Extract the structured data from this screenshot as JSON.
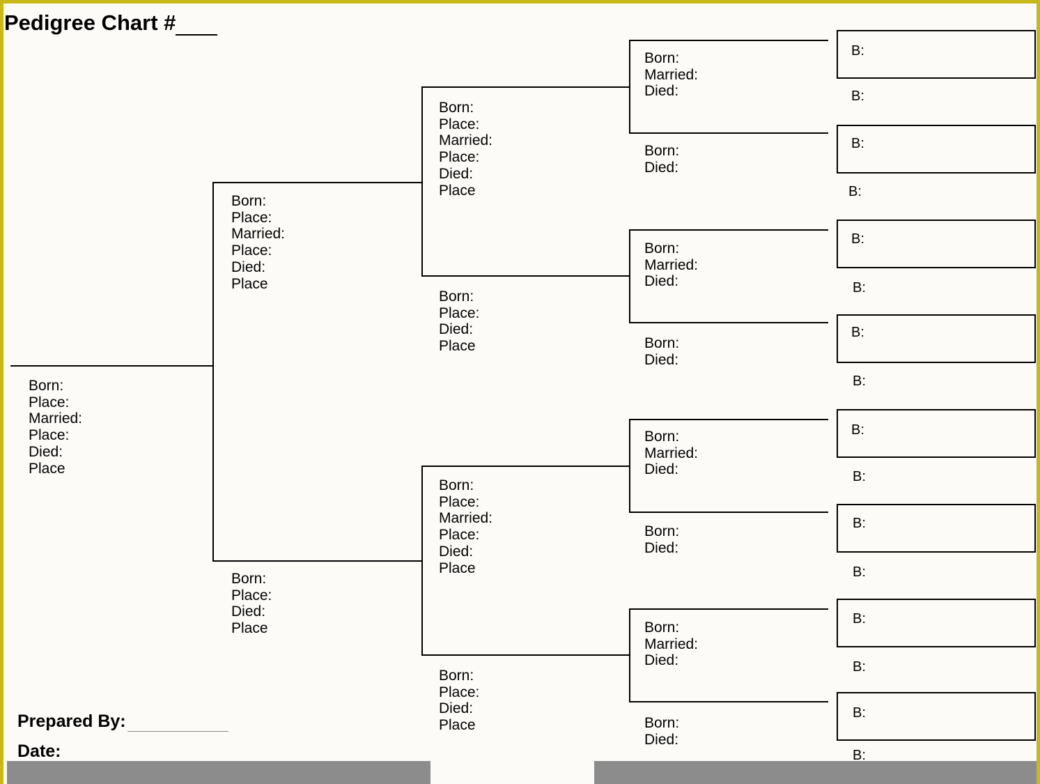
{
  "title_prefix": "Pedigree Chart #",
  "footer": {
    "prepared_by_label": "Prepared By:",
    "date_label": "Date:"
  },
  "labels": {
    "born": "Born:",
    "place": "Place:",
    "married": "Married:",
    "died": "Died:",
    "place_nocolon": "Place",
    "b": "B:"
  },
  "generation1": {
    "person1": {
      "lines": [
        "Born:",
        "Place:",
        "Married:",
        "Place:",
        "Died:",
        "Place"
      ]
    }
  },
  "generation2": {
    "father": {
      "lines": [
        "Born:",
        "Place:",
        "Married:",
        "Place:",
        "Died:",
        "Place"
      ]
    },
    "mother": {
      "lines": [
        "Born:",
        "Place:",
        "Died:",
        "Place"
      ]
    }
  },
  "generation3": {
    "p1": {
      "lines": [
        "Born:",
        "Place:",
        "Married:",
        "Place:",
        "Died:",
        "Place"
      ]
    },
    "p2": {
      "lines": [
        "Born:",
        "Place:",
        "Died:",
        "Place"
      ]
    },
    "p3": {
      "lines": [
        "Born:",
        "Place:",
        "Married:",
        "Place:",
        "Died:",
        "Place"
      ]
    },
    "p4": {
      "lines": [
        "Born:",
        "Place:",
        "Died:",
        "Place"
      ]
    }
  },
  "generation4": {
    "p1": {
      "lines": [
        "Born:",
        "Married:",
        "Died:"
      ]
    },
    "p2": {
      "lines": [
        "Born:",
        "Died:"
      ]
    },
    "p3": {
      "lines": [
        "Born:",
        "Married:",
        "Died:"
      ]
    },
    "p4": {
      "lines": [
        "Born:",
        "Died:"
      ]
    },
    "p5": {
      "lines": [
        "Born:",
        "Married:",
        "Died:"
      ]
    },
    "p6": {
      "lines": [
        "Born:",
        "Died:"
      ]
    },
    "p7": {
      "lines": [
        "Born:",
        "Married:",
        "Died:"
      ]
    },
    "p8": {
      "lines": [
        "Born:",
        "Died:"
      ]
    }
  }
}
